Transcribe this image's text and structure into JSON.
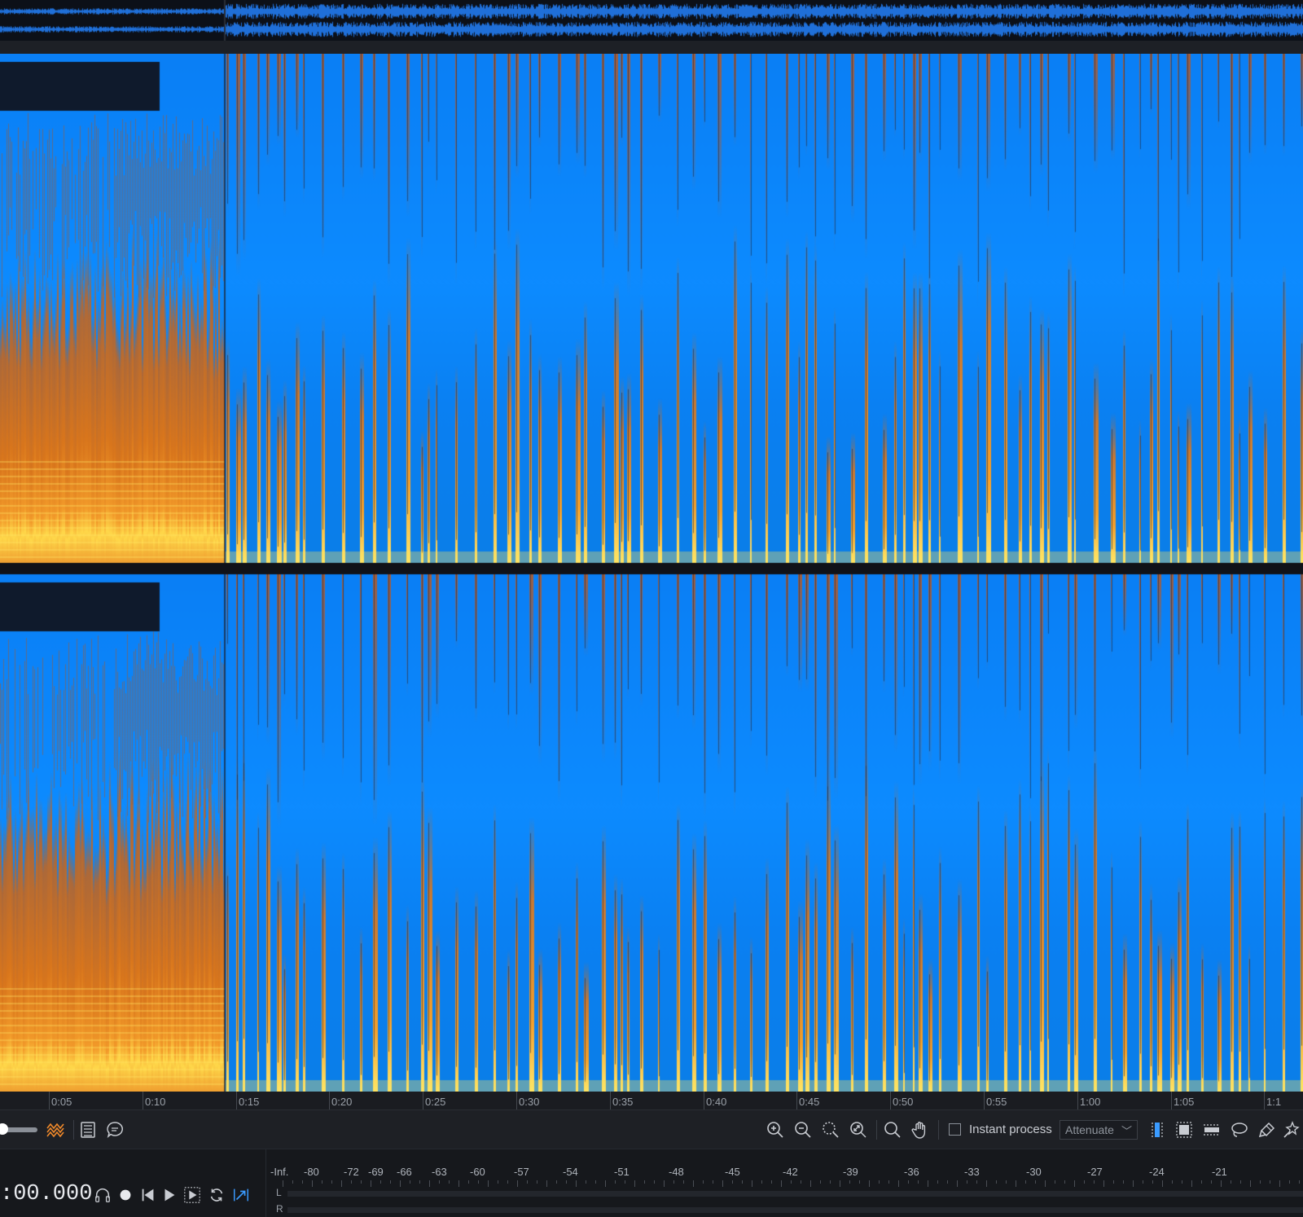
{
  "timeline": {
    "labels": [
      "0:05",
      "0:10",
      "0:15",
      "0:20",
      "0:25",
      "0:30",
      "0:35",
      "0:40",
      "0:45",
      "0:50",
      "0:55",
      "1:00",
      "1:05",
      "1:1"
    ]
  },
  "toolbar": {
    "instant_process_label": "Instant process",
    "instant_process_checked": false,
    "mode_value": "Attenuate",
    "icons": [
      "zoom-in-icon",
      "zoom-out-icon",
      "zoom-selection-icon",
      "zoom-fit-icon",
      "magnifier-icon",
      "hand-icon"
    ],
    "tool_icons": [
      "time-selection-icon",
      "rect-selection-icon",
      "frequency-selection-icon",
      "lasso-icon",
      "brush-icon",
      "magic-wand-icon"
    ]
  },
  "transport": {
    "time": ":00.000",
    "buttons": [
      "headphones-icon",
      "record-icon",
      "skip-back-icon",
      "play-icon",
      "play-selection-icon",
      "loop-icon",
      "follow-icon"
    ]
  },
  "meter": {
    "labels": [
      "-Inf.",
      "-80",
      "-72",
      "-69",
      "-66",
      "-63",
      "-60",
      "-57",
      "-54",
      "-51",
      "-48",
      "-45",
      "-42",
      "-39",
      "-36",
      "-33",
      "-30",
      "-27",
      "-24",
      "-21"
    ],
    "channel_left": "L",
    "channel_right": "R"
  },
  "colors": {
    "waveform": "#0a84ff",
    "spectrogram_high": "#ffe66a",
    "spectrogram_mid": "#e0781a",
    "accent": "#3a9bff"
  }
}
